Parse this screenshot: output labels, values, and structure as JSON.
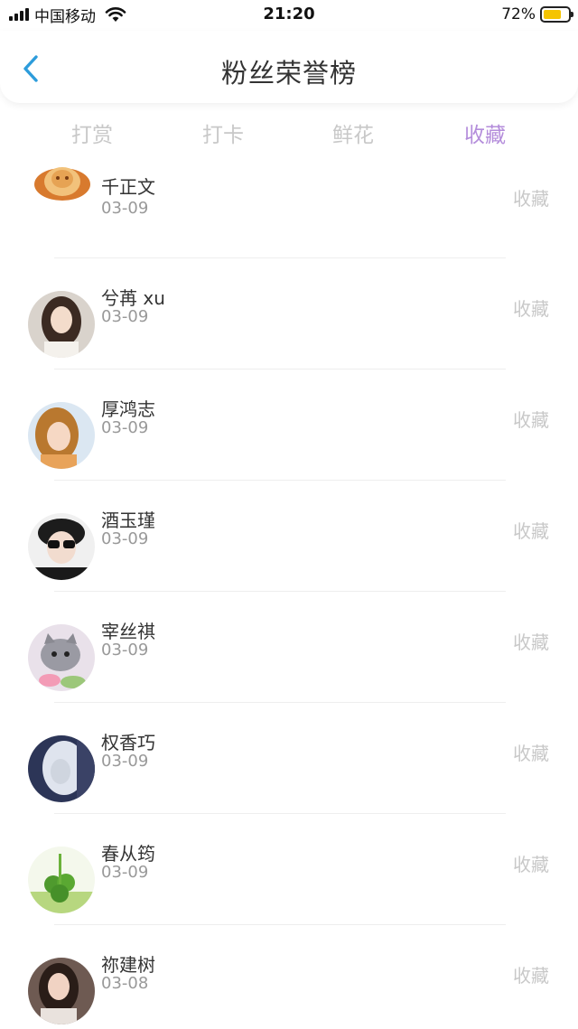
{
  "status_bar": {
    "carrier": "中国移动",
    "time": "21:20",
    "battery_percent": "72%",
    "battery_level": 0.72,
    "battery_color": "#f5c400"
  },
  "nav": {
    "title": "粉丝荣誉榜",
    "back_icon": "chevron-left-icon",
    "accent": "#2d9cdb"
  },
  "tabs": [
    {
      "label": "打赏",
      "active": false
    },
    {
      "label": "打卡",
      "active": false
    },
    {
      "label": "鲜花",
      "active": false
    },
    {
      "label": "收藏",
      "active": true
    }
  ],
  "active_tab_color": "#b48ddb",
  "fans": [
    {
      "name": "千正文",
      "date": "03-09",
      "type": "收藏",
      "avatar": "hat-avatar"
    },
    {
      "name": "兮苒 xu",
      "date": "03-09",
      "type": "收藏",
      "avatar": "girl-avatar"
    },
    {
      "name": "厚鸿志",
      "date": "03-09",
      "type": "收藏",
      "avatar": "child-avatar"
    },
    {
      "name": "酒玉瑾",
      "date": "03-09",
      "type": "收藏",
      "avatar": "sunglasses-avatar"
    },
    {
      "name": "宰丝祺",
      "date": "03-09",
      "type": "收藏",
      "avatar": "cat-avatar"
    },
    {
      "name": "权香巧",
      "date": "03-09",
      "type": "收藏",
      "avatar": "portrait-avatar"
    },
    {
      "name": "春从筠",
      "date": "03-09",
      "type": "收藏",
      "avatar": "clover-avatar"
    },
    {
      "name": "祢建树",
      "date": "03-08",
      "type": "收藏",
      "avatar": "woman-avatar"
    }
  ]
}
